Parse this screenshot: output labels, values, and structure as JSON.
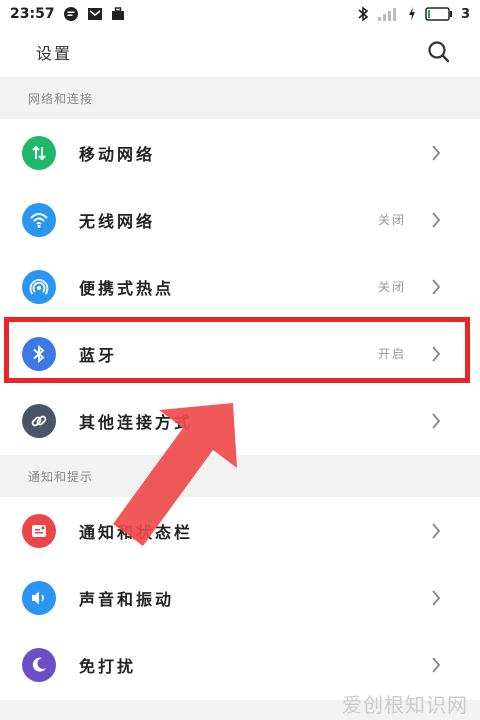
{
  "status_bar": {
    "time": "23:57",
    "battery_text": "3",
    "left_icons": [
      "chat-icon",
      "mail-icon",
      "suitcase-icon"
    ],
    "right_icons": [
      "bluetooth-icon",
      "signal-icon",
      "charging-icon",
      "battery-icon"
    ]
  },
  "header": {
    "title": "设置",
    "search_icon": "search-icon"
  },
  "sections": [
    {
      "title": "网络和连接",
      "items": [
        {
          "label": "移动网络",
          "value": "",
          "icon": "mobile-data-icon",
          "color": "#1fb86a"
        },
        {
          "label": "无线网络",
          "value": "关闭",
          "icon": "wifi-icon",
          "color": "#2b95f2"
        },
        {
          "label": "便携式热点",
          "value": "关闭",
          "icon": "hotspot-icon",
          "color": "#2b95f2"
        },
        {
          "label": "蓝牙",
          "value": "开启",
          "icon": "bluetooth-icon",
          "color": "#3c78e6"
        },
        {
          "label": "其他连接方式",
          "value": "",
          "icon": "link-icon",
          "color": "#4a5565"
        }
      ]
    },
    {
      "title": "通知和提示",
      "items": [
        {
          "label": "通知和状态栏",
          "value": "",
          "icon": "notification-icon",
          "color": "#e9474a"
        },
        {
          "label": "声音和振动",
          "value": "",
          "icon": "sound-icon",
          "color": "#2b95f2"
        },
        {
          "label": "免打扰",
          "value": "",
          "icon": "moon-icon",
          "color": "#6a4fc9"
        }
      ]
    }
  ],
  "annotation": {
    "highlight_color": "#e8262a",
    "arrow_color": "#ef4b4b"
  },
  "watermark": "爱创根知识网"
}
